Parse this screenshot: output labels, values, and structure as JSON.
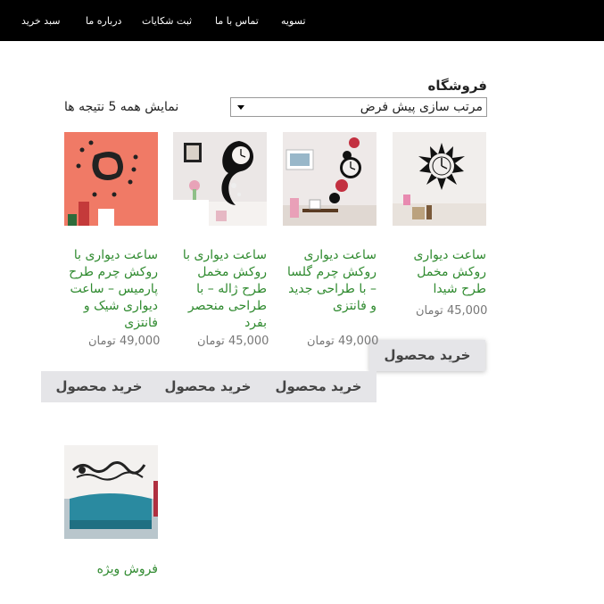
{
  "nav": {
    "items": [
      "تسویه",
      "تماس با ما",
      "ثبت شکایات",
      "درباره ما",
      "سبد خرید"
    ]
  },
  "shop": {
    "title": "فروشگاه",
    "sort_value": "مرتب سازی پیش فرض",
    "result_count": "نمایش همه 5 نتیجه ها"
  },
  "products": [
    {
      "title": "ساعت دیواری روکش مخمل طرح شیدا",
      "price": "45,000 تومان",
      "buy": "خرید محصول"
    },
    {
      "title": "ساعت دیواری روکش چرم گلسا – با طراحی جدید و فانتزی",
      "price": "49,000 تومان",
      "buy": "خرید محصول"
    },
    {
      "title": "ساعت دیواری با روکش مخمل طرح ژاله – با طراحی منحصر بفرد",
      "price": "45,000 تومان",
      "buy": "خرید محصول"
    },
    {
      "title": "ساعت دیواری با روکش چرم طرح پارمیس – ساعت دیواری شیک و فانتزی",
      "price": "49,000 تومان",
      "buy": "خرید محصول"
    },
    {
      "title": "فروش ویژه"
    }
  ],
  "colors": {
    "nav_bg": "#000000",
    "link_green": "#2f8a2f",
    "button_bg": "#e5e5e8"
  }
}
